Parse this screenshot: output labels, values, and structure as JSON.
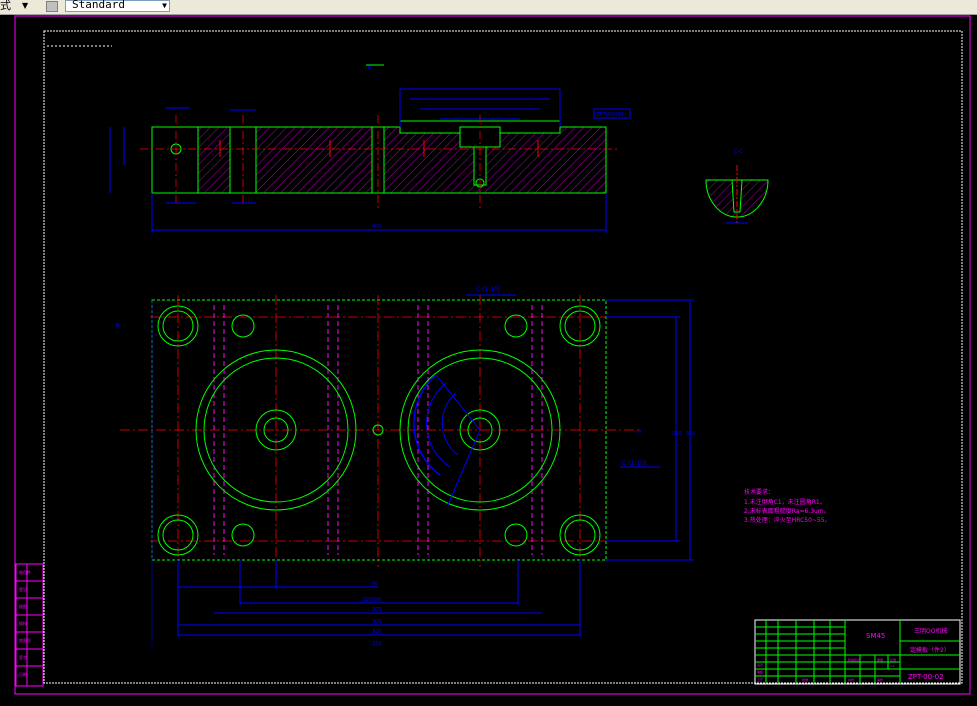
{
  "toolbar": {
    "style_fragment": "式",
    "style_combo_value": "Standard",
    "dropdown_glyph": "▼",
    "icon": "text-style-icon"
  },
  "drawing": {
    "section_mark_top": "B",
    "dim_width": "400",
    "dim_right_tag": "ZPT(00)(01)",
    "section_view_label": "C-C",
    "plan_label_top": "C (1:10)",
    "plan_label_right": "C (1:10)",
    "side_dim": "250",
    "side_dim_2": "300",
    "bottom_dims": [
      "60",
      "220(00)",
      "270",
      "300",
      "320",
      "370"
    ],
    "mark_a": "A",
    "mark_b": "B",
    "notes": [
      "技术要求：",
      "1.未注倒角C1，未注圆角R1。",
      "2.未标表面粗糙度Ra=6.3um。",
      "3.热处理：淬火至HRC50~55。"
    ]
  },
  "title_block": {
    "material": "SM45",
    "company": "三明OO机械",
    "part_name": "定模板（件2）",
    "drawing_no": "ZPT-00-02",
    "small_labels": [
      "标记",
      "处数",
      "分区",
      "更改文件号",
      "签名",
      "年月日",
      "设计",
      "标准化",
      "审核",
      "工艺",
      "批准",
      "阶段标记",
      "重量",
      "比例",
      "共张",
      "第张",
      "1:1"
    ]
  },
  "left_strip": {
    "labels": [
      "借用件",
      "登记",
      "描图",
      "描校",
      "底图号",
      "签字",
      "日期"
    ]
  },
  "colors": {
    "magenta": "#ff00ff",
    "green": "#00ff00",
    "red": "#ff0000",
    "blue": "#0000ff",
    "cyan": "#00ffff",
    "white": "#ffffff",
    "yellow": "#ffff00"
  }
}
